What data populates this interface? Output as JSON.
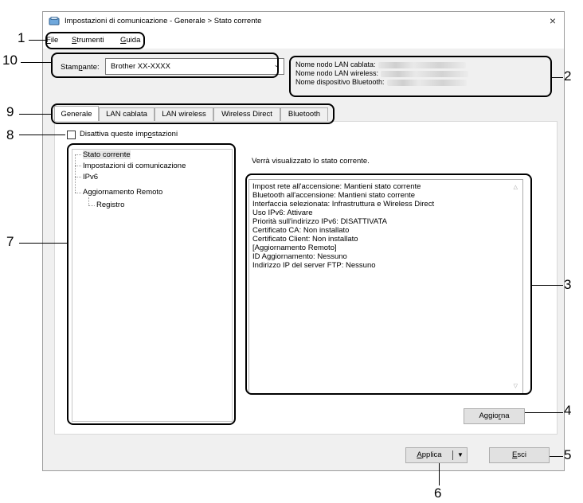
{
  "window": {
    "title": "Impostazioni di comunicazione - Generale > Stato corrente",
    "close_glyph": "×"
  },
  "menu": {
    "file": {
      "key": "F",
      "rest": "ile"
    },
    "strumenti": {
      "key": "S",
      "rest": "trumenti"
    },
    "guida": {
      "key": "G",
      "rest": "uida"
    }
  },
  "printer": {
    "label_pre": "Stam",
    "label_key": "p",
    "label_post": "ante:",
    "selected": "Brother  XX-XXXX"
  },
  "node_names": {
    "lan_cablata": "Nome nodo LAN cablata:",
    "lan_wireless": "Nome nodo LAN wireless:",
    "bluetooth": "Nome dispositivo Bluetooth:"
  },
  "tabs": [
    {
      "label": "Generale"
    },
    {
      "label": "LAN cablata"
    },
    {
      "label": "LAN wireless"
    },
    {
      "label": "Wireless Direct"
    },
    {
      "label": "Bluetooth"
    }
  ],
  "disable_settings": {
    "pre": "Disattiva queste imp",
    "key": "o",
    "post": "stazioni"
  },
  "tree": {
    "items": [
      {
        "label": "Stato corrente"
      },
      {
        "label": "Impostazioni di comunicazione"
      },
      {
        "label": "IPv6"
      },
      {
        "label": "Aggiornamento Remoto"
      },
      {
        "label": "Registro"
      }
    ]
  },
  "status": {
    "caption": "Verrà visualizzato lo stato corrente.",
    "lines": [
      "Impost rete all'accensione: Mantieni stato corrente",
      "Bluetooth all'accensione: Mantieni stato corrente",
      "Interfaccia selezionata: Infrastruttura e Wireless Direct",
      "Uso IPv6: Attivare",
      "Priorità sull'indirizzo IPv6: DISATTIVATA",
      "Certificato CA: Non installato",
      "Certificato Client: Non installato",
      "[Aggiornamento Remoto]",
      "ID Aggiornamento: Nessuno",
      "Indirizzo IP del server FTP: Nessuno"
    ]
  },
  "buttons": {
    "aggiorna": {
      "pre": "Aggio",
      "key": "r",
      "post": "na"
    },
    "applica": {
      "pre": "",
      "key": "A",
      "post": "pplica"
    },
    "esci": {
      "pre": "",
      "key": "E",
      "post": "sci"
    }
  },
  "callouts": {
    "n1": "1",
    "n2": "2",
    "n3": "3",
    "n4": "4",
    "n5": "5",
    "n6": "6",
    "n7": "7",
    "n8": "8",
    "n9": "9",
    "n10": "10"
  }
}
